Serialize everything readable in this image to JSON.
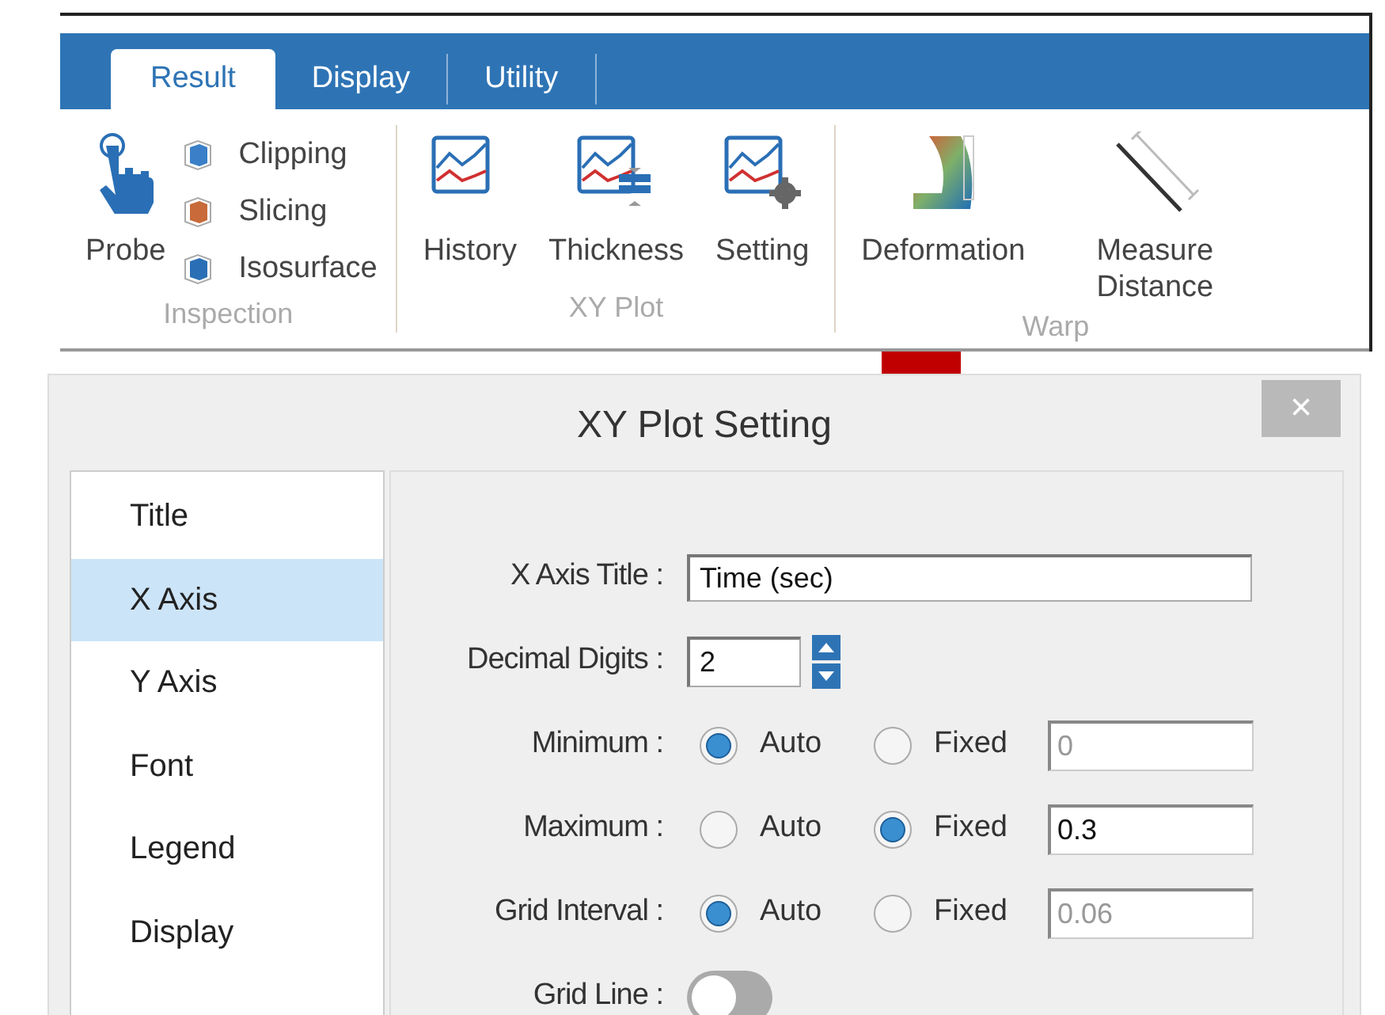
{
  "ribbon": {
    "tabs": [
      {
        "label": "Result",
        "selected": true
      },
      {
        "label": "Display",
        "selected": false
      },
      {
        "label": "Utility",
        "selected": false
      }
    ],
    "groups": [
      {
        "label": "Inspection",
        "items": [
          {
            "kind": "large",
            "label": "Probe"
          },
          {
            "kind": "small",
            "label": "Clipping"
          },
          {
            "kind": "small",
            "label": "Slicing"
          },
          {
            "kind": "small",
            "label": "Isosurface"
          }
        ]
      },
      {
        "label": "XY Plot",
        "items": [
          {
            "kind": "large",
            "label": "History"
          },
          {
            "kind": "large",
            "label": "Thickness"
          },
          {
            "kind": "large",
            "label": "Setting"
          }
        ]
      },
      {
        "label": "Warp",
        "items": [
          {
            "kind": "large",
            "label": "Deformation"
          },
          {
            "kind": "large",
            "label": "Measure Distance"
          }
        ]
      }
    ]
  },
  "dialog": {
    "title": "XY Plot Setting",
    "close": "×",
    "nav": [
      {
        "label": "Title",
        "selected": false
      },
      {
        "label": "X Axis",
        "selected": true
      },
      {
        "label": "Y Axis",
        "selected": false
      },
      {
        "label": "Font",
        "selected": false
      },
      {
        "label": "Legend",
        "selected": false
      },
      {
        "label": "Display",
        "selected": false
      }
    ],
    "rows": [
      {
        "kind": "text",
        "label": "X Axis Title :",
        "value": "Time (sec)"
      },
      {
        "kind": "spinner",
        "label": "Decimal Digits :",
        "value": "2"
      },
      {
        "kind": "radio",
        "label": "Minimum :",
        "options": [
          {
            "label": "Auto",
            "selected": true
          },
          {
            "label": "Fixed",
            "selected": false
          }
        ],
        "value": "0",
        "disabled": true
      },
      {
        "kind": "radio",
        "label": "Maximum :",
        "options": [
          {
            "label": "Auto",
            "selected": false
          },
          {
            "label": "Fixed",
            "selected": true
          }
        ],
        "value": "0.3",
        "disabled": false
      },
      {
        "kind": "radio",
        "label": "Grid Interval :",
        "options": [
          {
            "label": "Auto",
            "selected": true
          },
          {
            "label": "Fixed",
            "selected": false
          }
        ],
        "value": "0.06",
        "disabled": true
      },
      {
        "kind": "toggle",
        "label": "Grid Line :",
        "on": false
      }
    ]
  }
}
